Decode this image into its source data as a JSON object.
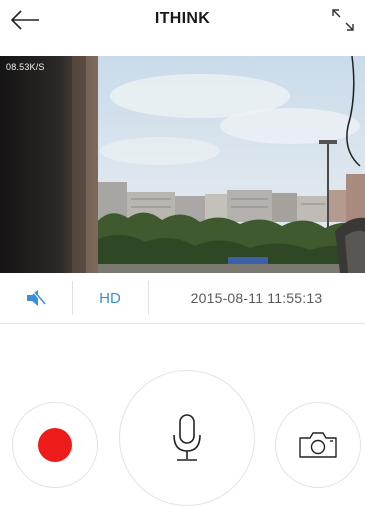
{
  "header": {
    "title": "ITHINK",
    "back_icon": "arrow-left-icon",
    "fullscreen_icon": "expand-diagonal-icon"
  },
  "video": {
    "bitrate": "08.53K/S"
  },
  "controls": {
    "mute_icon": "speaker-mute-icon",
    "hd_label": "HD",
    "datetime": "2015-08-11 11:55:13"
  },
  "actions": {
    "record_icon": "record-dot-icon",
    "mic_icon": "microphone-icon",
    "snapshot_icon": "camera-icon"
  },
  "colors": {
    "accent": "#3a8fd6",
    "record": "#ee1b1b"
  }
}
